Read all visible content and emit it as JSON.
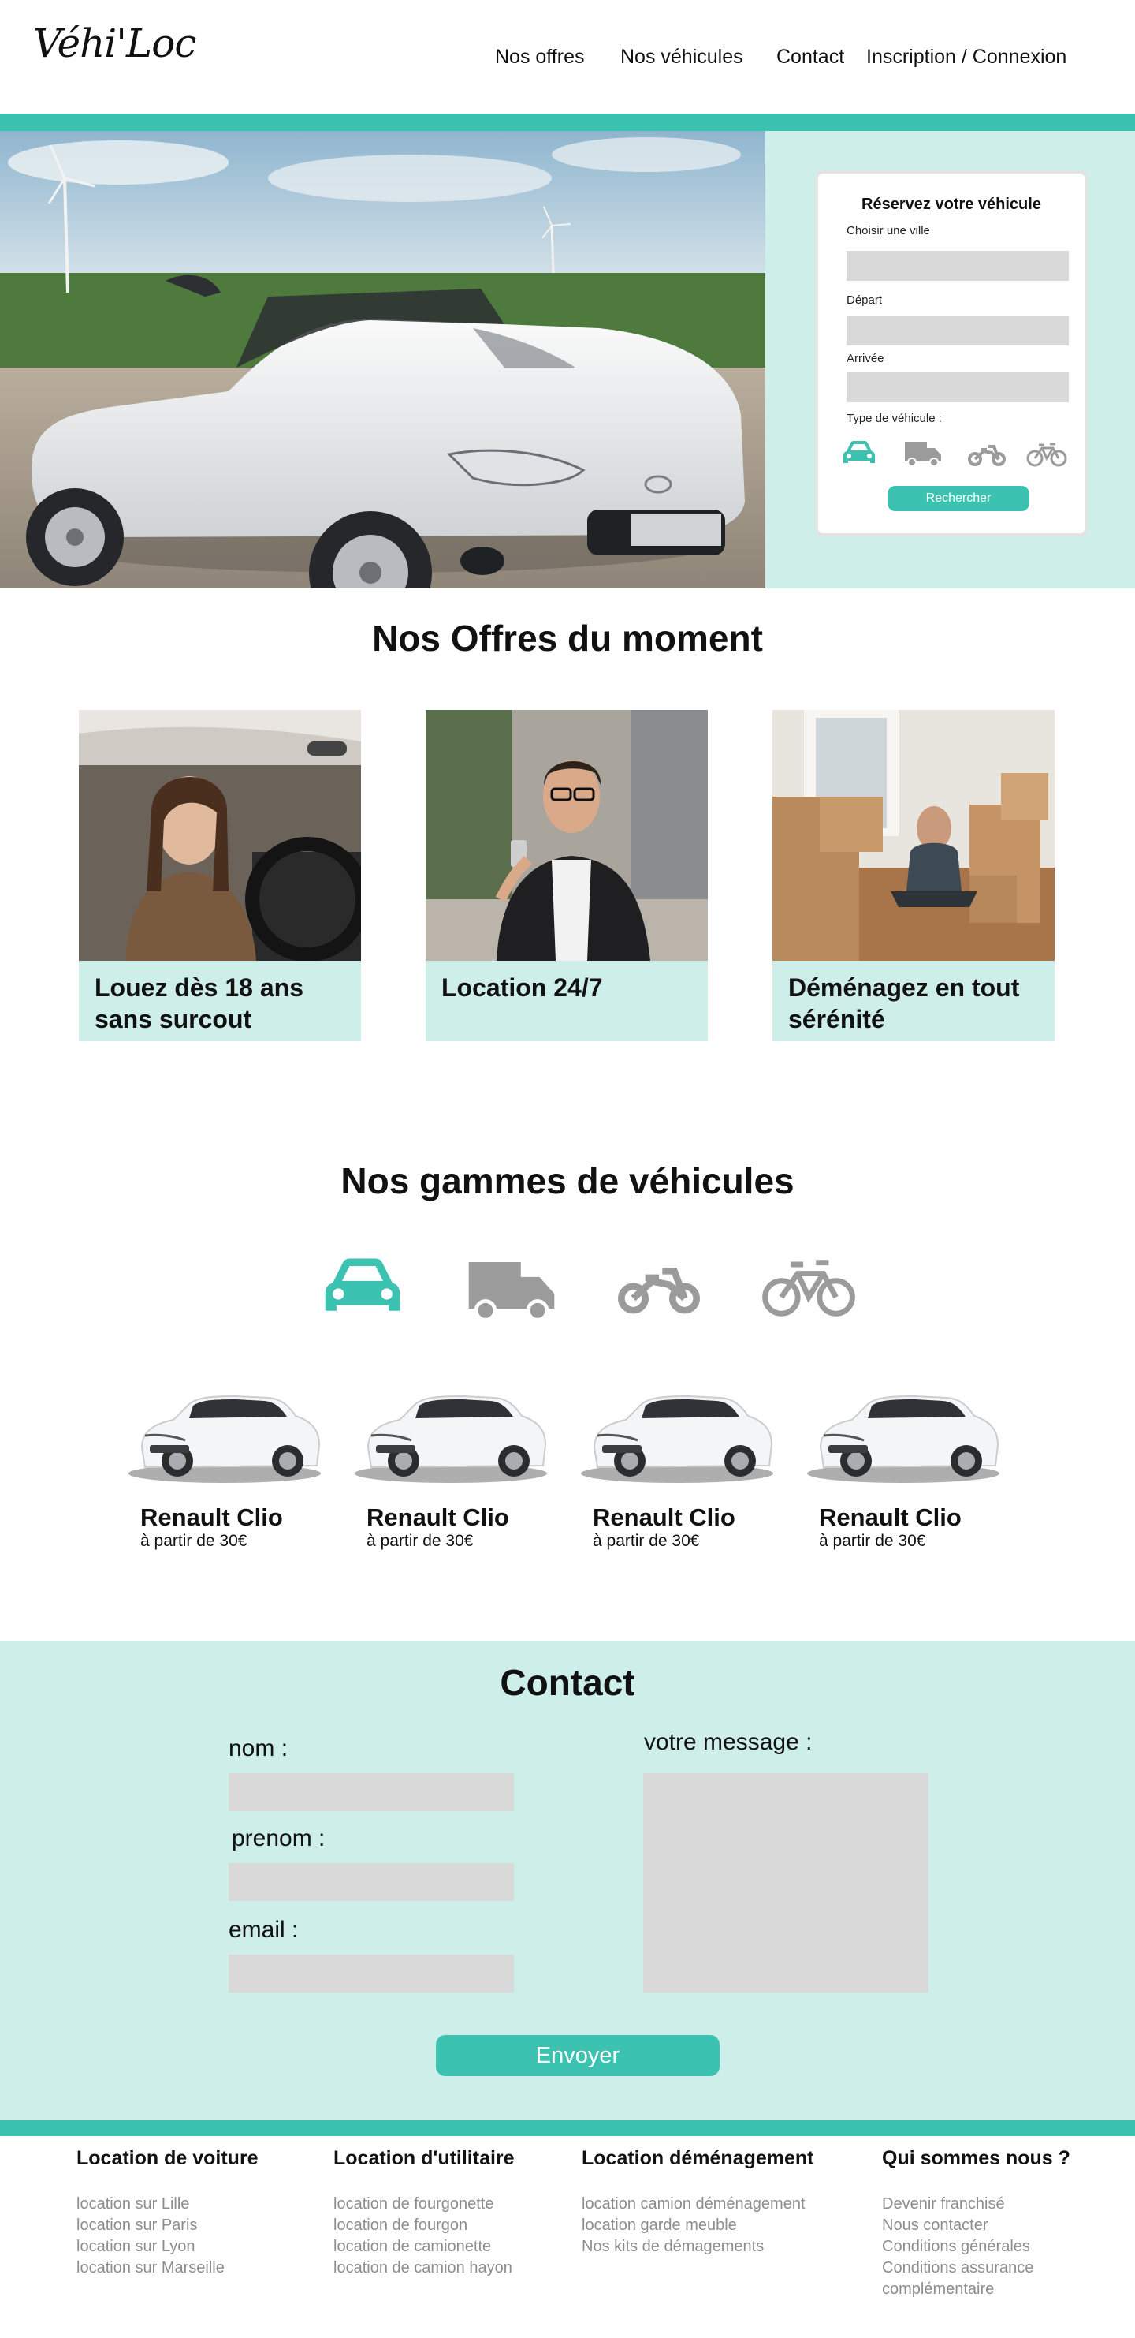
{
  "header": {
    "logo": "Véhi'Loc",
    "nav": [
      "Nos offres",
      "Nos véhicules",
      "Contact",
      "Inscription / Connexion"
    ]
  },
  "booking": {
    "title": "Réservez votre véhicule",
    "city_label": "Choisir une ville",
    "city_value": "",
    "departure_label": "Départ",
    "departure_value": "",
    "arrival_label": "Arrivée",
    "arrival_value": "",
    "vehicle_type_label": "Type de véhicule :",
    "vehicle_types": [
      "car-icon",
      "truck-icon",
      "motorbike-icon",
      "bicycle-icon"
    ],
    "selected_vehicle_type": "car-icon",
    "search_button": "Rechercher"
  },
  "offers": {
    "title": "Nos Offres du moment",
    "items": [
      {
        "caption": "Louez dès 18 ans sans surcout",
        "image": "young-driver-photo"
      },
      {
        "caption": "Location 24/7",
        "image": "man-with-phone-photo"
      },
      {
        "caption": "Déménagez en tout sérénité",
        "image": "moving-boxes-photo"
      }
    ]
  },
  "ranges": {
    "title": "Nos gammes de véhicules",
    "icons": [
      "car-icon",
      "truck-icon",
      "motorbike-icon",
      "bicycle-icon"
    ],
    "selected": "car-icon",
    "cars": [
      {
        "name": "Renault Clio",
        "price": "à partir de 30€"
      },
      {
        "name": "Renault Clio",
        "price": "à partir de 30€"
      },
      {
        "name": "Renault Clio",
        "price": "à partir de 30€"
      },
      {
        "name": "Renault Clio",
        "price": "à partir de 30€"
      }
    ]
  },
  "contact": {
    "title": "Contact",
    "nom_label": "nom :",
    "prenom_label": "prenom :",
    "email_label": "email :",
    "message_label": "votre message :",
    "send_button": "Envoyer"
  },
  "footer": {
    "columns": [
      {
        "title": "Location de voiture",
        "links": [
          "location sur Lille",
          "location sur Paris",
          "location sur Lyon",
          "location sur Marseille"
        ]
      },
      {
        "title": "Location d'utilitaire",
        "links": [
          "location de fourgonette",
          "location de fourgon",
          "location de camionette",
          "location de camion hayon"
        ]
      },
      {
        "title": "Location déménagement",
        "links": [
          "location camion déménagement",
          "location garde meuble",
          "Nos kits de démagements"
        ]
      },
      {
        "title": "Qui sommes nous ?",
        "links": [
          "Devenir franchisé",
          "Nous contacter",
          "Conditions générales",
          "Conditions assurance complémentaire"
        ]
      }
    ]
  },
  "colors": {
    "accent": "#3cc2b0",
    "light_accent": "#cdeee9",
    "input_gray": "#d9d9d9",
    "inactive_icon": "#9b9b9b",
    "footer_link": "#8d8d8d"
  }
}
